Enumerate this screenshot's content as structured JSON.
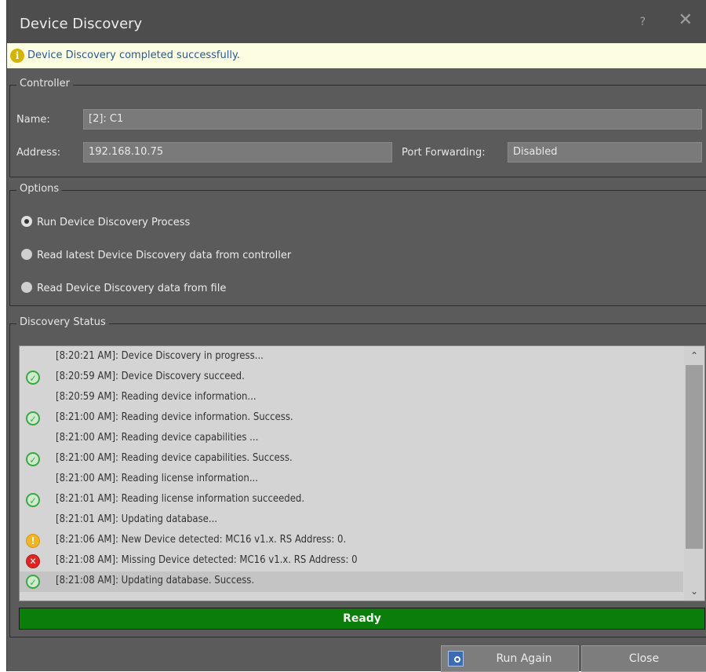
{
  "window": {
    "title": "Device Discovery",
    "help_label": "?",
    "close_label": "✕"
  },
  "info": {
    "text": "Device Discovery completed successfully.",
    "icon": "info-icon"
  },
  "controller": {
    "group_title": "Controller",
    "name_label": "Name:",
    "name_value": "[2]: C1",
    "address_label": "Address:",
    "address_value": "192.168.10.75",
    "port_label": "Port Forwarding:",
    "port_value": "Disabled"
  },
  "options": {
    "group_title": "Options",
    "items": [
      {
        "label": "Run Device Discovery Process",
        "selected": true
      },
      {
        "label": "Read latest Device Discovery data from controller",
        "selected": false
      },
      {
        "label": "Read Device Discovery data from file",
        "selected": false
      }
    ]
  },
  "status": {
    "group_title": "Discovery Status",
    "log": [
      {
        "icon": "none",
        "text": "[8:20:21 AM]: Device Discovery in progress..."
      },
      {
        "icon": "ok",
        "text": "[8:20:59 AM]: Device Discovery succeed."
      },
      {
        "icon": "none",
        "text": "[8:20:59 AM]: Reading device information..."
      },
      {
        "icon": "ok",
        "text": "[8:21:00 AM]: Reading device information. Success."
      },
      {
        "icon": "none",
        "text": "[8:21:00 AM]: Reading device capabilities ..."
      },
      {
        "icon": "ok",
        "text": "[8:21:00 AM]: Reading device capabilities. Success."
      },
      {
        "icon": "none",
        "text": "[8:21:00 AM]: Reading license information..."
      },
      {
        "icon": "ok",
        "text": "[8:21:01 AM]: Reading license information succeeded."
      },
      {
        "icon": "none",
        "text": "[8:21:01 AM]: Updating database..."
      },
      {
        "icon": "warn",
        "text": "[8:21:06 AM]: New Device detected: MC16 v1.x. RS Address: 0."
      },
      {
        "icon": "err",
        "text": "[8:21:08 AM]: Missing Device detected: MC16 v1.x. RS Address: 0"
      },
      {
        "icon": "ok",
        "text": "[8:21:08 AM]: Updating database. Success."
      }
    ],
    "progress_label": "Ready",
    "progress_percent": 100,
    "colors": {
      "progress": "#0b7d0b",
      "ok": "#3aa845",
      "warn": "#f0b429",
      "err": "#e02424"
    }
  },
  "buttons": {
    "run_again": "Run Again",
    "close": "Close"
  }
}
